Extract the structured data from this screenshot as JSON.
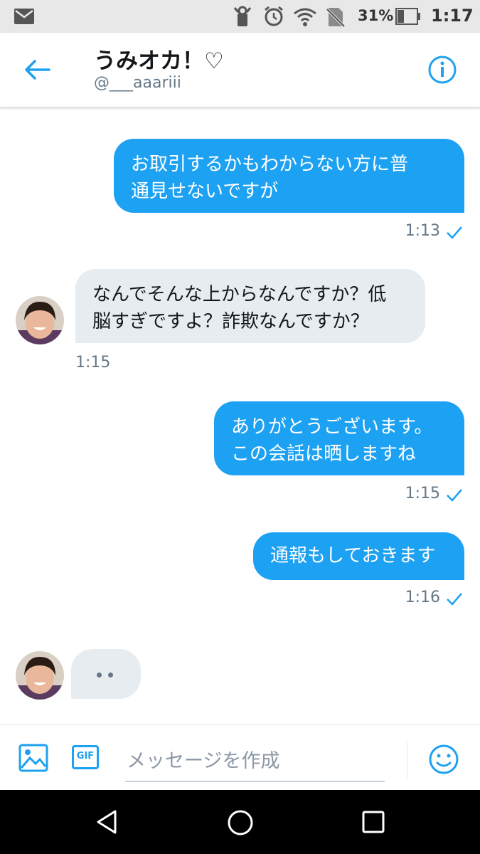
{
  "status_bar": {
    "battery": "31%",
    "time": "1:17",
    "icons": [
      "mail-icon",
      "alarm-icon",
      "wifi-icon",
      "no-sim-icon",
      "battery-icon"
    ]
  },
  "header": {
    "back_icon": "arrow-left-icon",
    "name": "うみオカ！♡",
    "handle": "@___aaariii",
    "info_icon": "info-icon"
  },
  "messages": [
    {
      "direction": "out",
      "text": "お取引するかもわからない方に普\n通見せないですが",
      "time": "1:13"
    },
    {
      "direction": "in",
      "text": "なんでそんな上からなんですか？低\n脳すぎですよ？詐欺なんですか？",
      "time": "1:15"
    },
    {
      "direction": "out",
      "text": "ありがとうございます。\nこの会話は晒しますね",
      "time": "1:15"
    },
    {
      "direction": "out",
      "text": "通報もしておきます",
      "time": "1:16"
    }
  ],
  "composer": {
    "placeholder": "メッセージを作成",
    "gif_label": "GIF"
  },
  "colors": {
    "accent": "#1da1f2",
    "incoming_bubble": "#e6ecf0",
    "timestamp": "#657786"
  }
}
